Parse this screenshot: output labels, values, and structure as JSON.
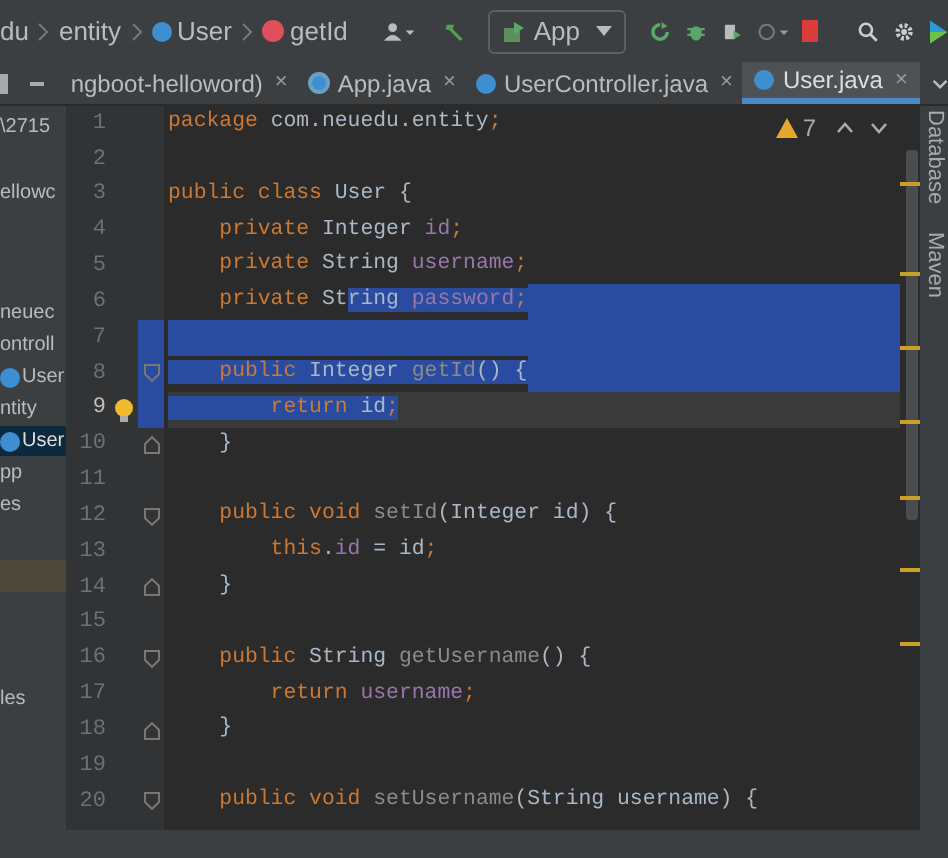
{
  "breadcrumbs": [
    {
      "text": "du",
      "kind": "folder"
    },
    {
      "text": "entity",
      "kind": "folder"
    },
    {
      "text": "User",
      "kind": "class"
    },
    {
      "text": "getId",
      "kind": "method"
    }
  ],
  "run_config": {
    "label": "App"
  },
  "tabs": [
    {
      "label": "ngboot-helloword)",
      "close": "×",
      "kind": "module",
      "selected": false
    },
    {
      "label": "App.java",
      "close": "×",
      "kind": "app",
      "selected": false
    },
    {
      "label": "UserController.java",
      "close": "×",
      "kind": "class",
      "selected": false
    },
    {
      "label": "User.java",
      "close": "×",
      "kind": "class",
      "selected": true
    }
  ],
  "project_tree": [
    {
      "label": "\\2715",
      "kind": "folder",
      "selected": false
    },
    {
      "label": "ellowc",
      "kind": "folder",
      "selected": false
    },
    {
      "label": "neuec",
      "kind": "folder",
      "selected": false
    },
    {
      "label": "ontroll",
      "kind": "folder",
      "selected": false
    },
    {
      "label": "User",
      "kind": "class",
      "selected": false
    },
    {
      "label": "ntity",
      "kind": "folder",
      "selected": false
    },
    {
      "label": "User",
      "kind": "class",
      "selected": true
    },
    {
      "label": "pp",
      "kind": "folder",
      "selected": false
    },
    {
      "label": "es",
      "kind": "folder",
      "selected": false
    },
    {
      "label": "les",
      "kind": "folder",
      "selected": false
    }
  ],
  "inspections": {
    "count": "7"
  },
  "code_lines": [
    {
      "number": "1",
      "kind": "plain",
      "tokens": [
        {
          "text": "package",
          "kind": "keyword"
        },
        {
          "text": " com.neuedu.entity",
          "kind": "plain"
        },
        {
          "text": ";",
          "kind": "keyword"
        }
      ]
    },
    {
      "number": "2",
      "kind": "plain"
    },
    {
      "number": "3",
      "kind": "plain",
      "tokens": [
        {
          "text": "public class",
          "kind": "keyword"
        },
        {
          "text": " User {",
          "kind": "plain"
        }
      ]
    },
    {
      "number": "4",
      "kind": "plain",
      "tokens": [
        {
          "text": "    private",
          "kind": "keyword"
        },
        {
          "text": " Integer ",
          "kind": "plain"
        },
        {
          "text": "id",
          "kind": "field"
        },
        {
          "text": ";",
          "kind": "keyword"
        }
      ]
    },
    {
      "number": "5",
      "kind": "plain",
      "tokens": [
        {
          "text": "    private",
          "kind": "keyword"
        },
        {
          "text": " String ",
          "kind": "plain"
        },
        {
          "text": "username",
          "kind": "field"
        },
        {
          "text": ";",
          "kind": "keyword"
        }
      ]
    },
    {
      "number": "6",
      "kind": "plain",
      "selected_to_end": true,
      "tokens": [
        {
          "text": "    private",
          "kind": "keyword",
          "selected": false
        },
        {
          "text": " St",
          "kind": "plain",
          "selected": false
        },
        {
          "text": "ring ",
          "kind": "plain",
          "selected": true
        },
        {
          "text": "password",
          "kind": "field",
          "selected": true
        },
        {
          "text": ";",
          "kind": "keyword",
          "selected": true
        }
      ]
    },
    {
      "number": "7",
      "kind": "plain",
      "selected_to_end": true
    },
    {
      "number": "8",
      "kind": "fold-start",
      "selected_to_end": true,
      "tokens": [
        {
          "text": "    public",
          "kind": "keyword",
          "selected": true
        },
        {
          "text": " Integer ",
          "kind": "plain",
          "selected": true
        },
        {
          "text": "getId",
          "kind": "unused",
          "selected": true
        },
        {
          "text": "() {",
          "kind": "plain",
          "selected": true
        }
      ]
    },
    {
      "number": "9",
      "kind": "bulb",
      "current": true,
      "selected_to_end": false,
      "tokens": [
        {
          "text": "        return",
          "kind": "keyword",
          "selected": true
        },
        {
          "text": " id",
          "kind": "plain",
          "selected": true
        },
        {
          "text": ";",
          "kind": "keyword",
          "selected": true
        }
      ]
    },
    {
      "number": "10",
      "kind": "fold-end",
      "tokens": [
        {
          "text": "    }",
          "kind": "plain"
        }
      ]
    },
    {
      "number": "11",
      "kind": "plain"
    },
    {
      "number": "12",
      "kind": "fold-start",
      "tokens": [
        {
          "text": "    public void",
          "kind": "keyword"
        },
        {
          "text": " setId",
          "kind": "unused"
        },
        {
          "text": "(Integer id) {",
          "kind": "plain"
        }
      ]
    },
    {
      "number": "13",
      "kind": "plain",
      "tokens": [
        {
          "text": "        this",
          "kind": "keyword"
        },
        {
          "text": ".",
          "kind": "plain"
        },
        {
          "text": "id",
          "kind": "field"
        },
        {
          "text": " = id",
          "kind": "plain"
        },
        {
          "text": ";",
          "kind": "keyword"
        }
      ]
    },
    {
      "number": "14",
      "kind": "fold-end",
      "tokens": [
        {
          "text": "    }",
          "kind": "plain"
        }
      ]
    },
    {
      "number": "15",
      "kind": "plain"
    },
    {
      "number": "16",
      "kind": "fold-start",
      "tokens": [
        {
          "text": "    public",
          "kind": "keyword"
        },
        {
          "text": " String ",
          "kind": "plain"
        },
        {
          "text": "getUsername",
          "kind": "unused"
        },
        {
          "text": "() {",
          "kind": "plain"
        }
      ]
    },
    {
      "number": "17",
      "kind": "plain",
      "tokens": [
        {
          "text": "        return ",
          "kind": "keyword"
        },
        {
          "text": "username",
          "kind": "field"
        },
        {
          "text": ";",
          "kind": "keyword"
        }
      ]
    },
    {
      "number": "18",
      "kind": "fold-end",
      "tokens": [
        {
          "text": "    }",
          "kind": "plain"
        }
      ]
    },
    {
      "number": "19",
      "kind": "plain"
    },
    {
      "number": "20",
      "kind": "fold-start",
      "tokens": [
        {
          "text": "    public void",
          "kind": "keyword"
        },
        {
          "text": " setUsername",
          "kind": "unused"
        },
        {
          "text": "(String username) {",
          "kind": "plain"
        }
      ]
    }
  ],
  "tool_windows": [
    "Database",
    "Maven"
  ]
}
